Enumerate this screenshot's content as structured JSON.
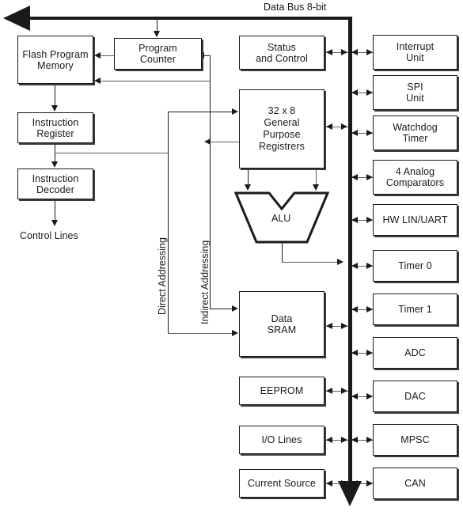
{
  "diagram": {
    "title": "Data Bus 8-bit",
    "bus_label": "Data Bus 8-bit",
    "colors": {
      "bus": "#1a1a1a",
      "box_border": "#1a1a1a",
      "box_fill": "#ffffff",
      "connector": "#5e5e5e",
      "background": "#ffffff"
    }
  },
  "left_column": {
    "blocks": [
      {
        "id": "flash-program-memory",
        "label": "Flash Program\nMemory"
      },
      {
        "id": "instruction-register",
        "label": "Instruction\nRegister"
      },
      {
        "id": "instruction-decoder",
        "label": "Instruction\nDecoder"
      }
    ],
    "output_label": "Control Lines"
  },
  "top_blocks": [
    {
      "id": "program-counter",
      "label": "Program\nCounter"
    }
  ],
  "addressing_labels": [
    {
      "id": "direct-addressing",
      "label": "Direct Addressing"
    },
    {
      "id": "indirect-addressing",
      "label": "Indirect Addressing"
    }
  ],
  "center_column": {
    "blocks": [
      {
        "id": "status-and-control",
        "label": "Status\nand Control"
      },
      {
        "id": "general-purpose-registers",
        "label": "32 x 8\nGeneral\nPurpose\nRegistrers"
      },
      {
        "id": "alu",
        "label": "ALU"
      },
      {
        "id": "data-sram",
        "label": "Data\nSRAM"
      },
      {
        "id": "eeprom",
        "label": "EEPROM"
      },
      {
        "id": "io-lines",
        "label": "I/O Lines"
      },
      {
        "id": "current-source",
        "label": "Current Source"
      }
    ]
  },
  "right_column": {
    "blocks": [
      {
        "id": "interrupt-unit",
        "label": "Interrupt\nUnit"
      },
      {
        "id": "spi-unit",
        "label": "SPI\nUnit"
      },
      {
        "id": "watchdog-timer",
        "label": "Watchdog\nTimer"
      },
      {
        "id": "analog-comparators",
        "label": "4 Analog\nComparators"
      },
      {
        "id": "hw-lin-uart",
        "label": "HW LIN/UART"
      },
      {
        "id": "timer-0",
        "label": "Timer 0"
      },
      {
        "id": "timer-1",
        "label": "Timer 1"
      },
      {
        "id": "adc",
        "label": "ADC"
      },
      {
        "id": "dac",
        "label": "DAC"
      },
      {
        "id": "mpsc",
        "label": "MPSC"
      },
      {
        "id": "can",
        "label": "CAN"
      }
    ]
  }
}
